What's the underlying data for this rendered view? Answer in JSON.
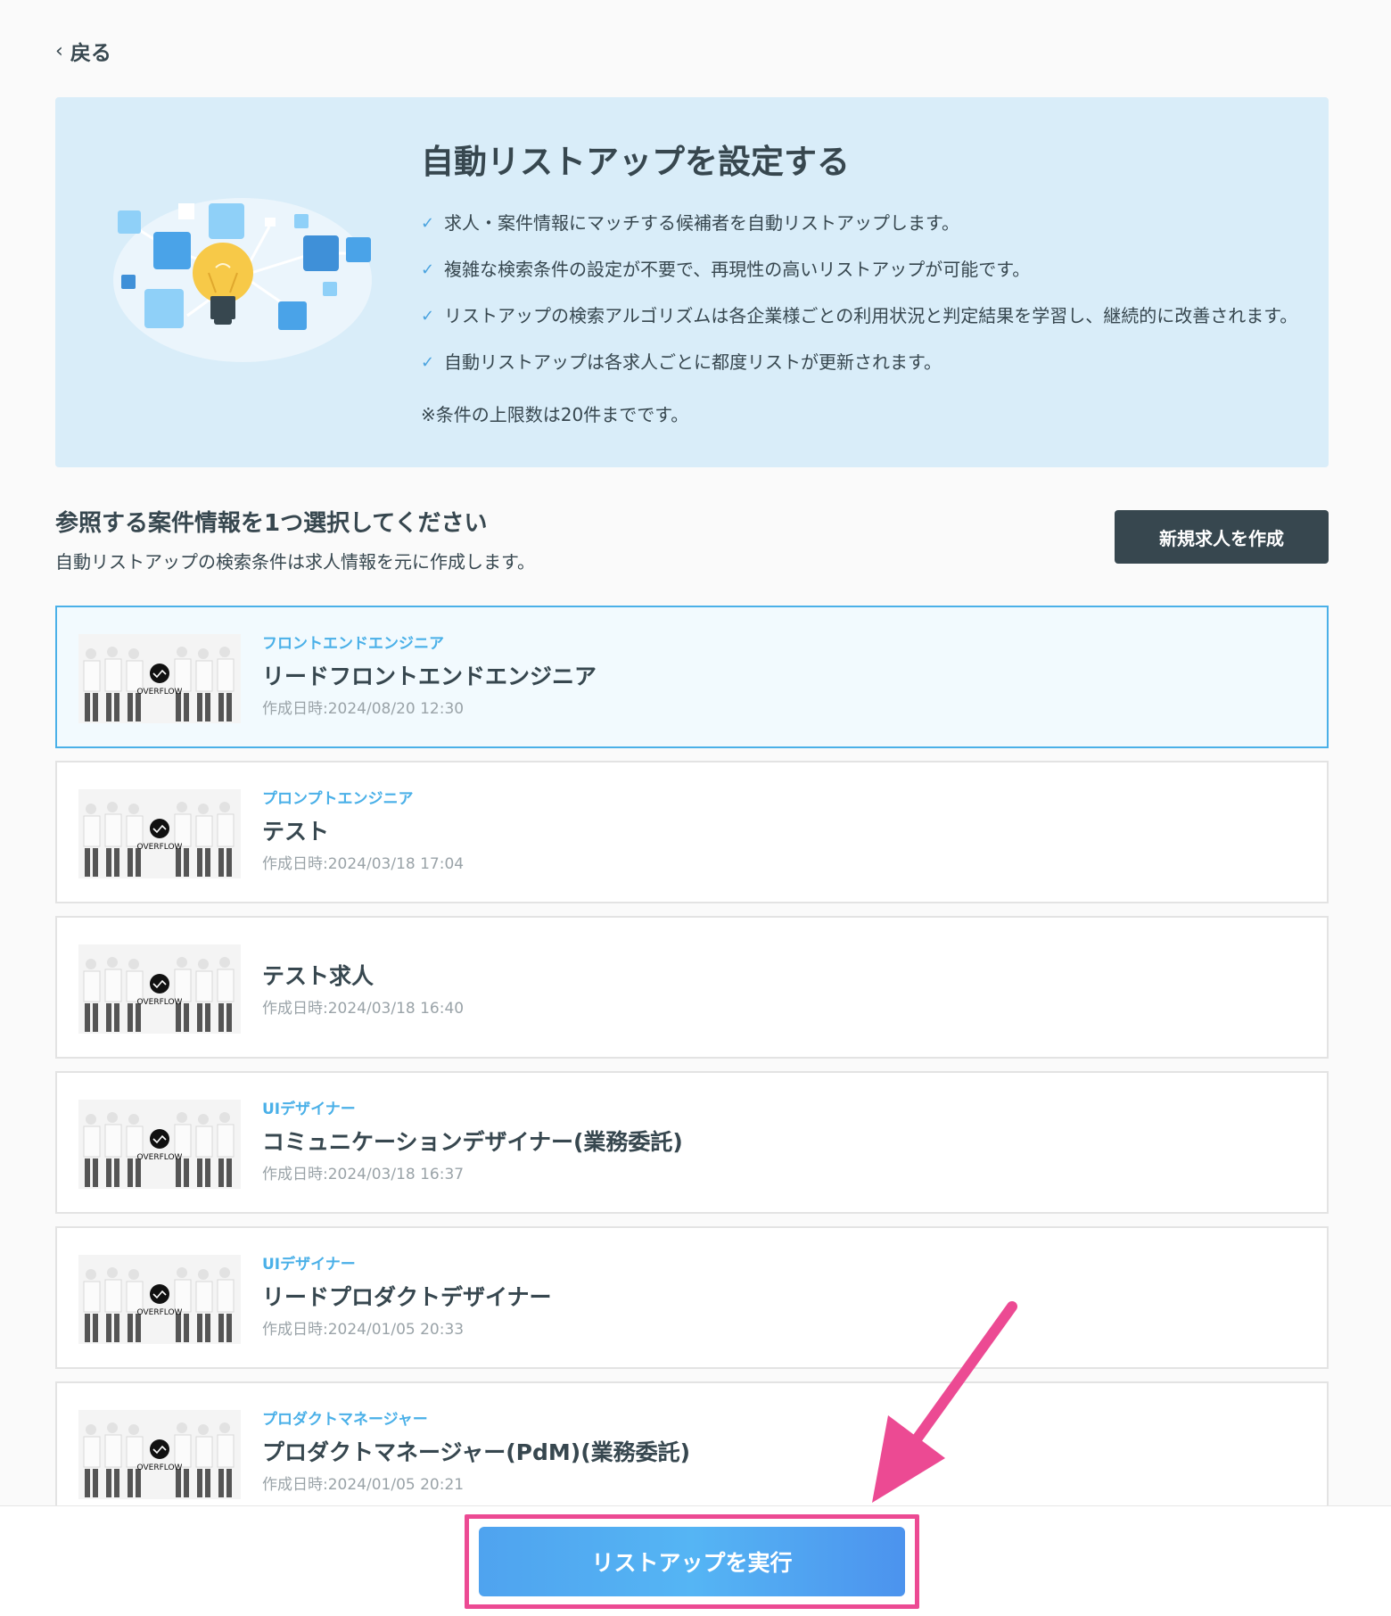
{
  "nav": {
    "back_label": "戻る"
  },
  "hero": {
    "title": "自動リストアップを設定する",
    "points": [
      "求人・案件情報にマッチする候補者を自動リストアップします。",
      "複雑な検索条件の設定が不要で、再現性の高いリストアップが可能です。",
      "リストアップの検索アルゴリズムは各企業様ごとの利用状況と判定結果を学習し、継続的に改善されます。",
      "自動リストアップは各求人ごとに都度リストが更新されます。"
    ],
    "note": "※条件の上限数は20件までです。"
  },
  "section": {
    "title": "参照する案件情報を1つ選択してください",
    "subtitle": "自動リストアップの検索条件は求人情報を元に作成します。",
    "new_button": "新規求人を作成"
  },
  "thumb_logo_text": "OVERFLOW",
  "jobs": [
    {
      "category": "フロントエンドエンジニア",
      "title": "リードフロントエンドエンジニア",
      "created": "作成日時:2024/08/20 12:30"
    },
    {
      "category": "プロンプトエンジニア",
      "title": "テスト",
      "created": "作成日時:2024/03/18 17:04"
    },
    {
      "category": "",
      "title": "テスト求人",
      "created": "作成日時:2024/03/18 16:40"
    },
    {
      "category": "UIデザイナー",
      "title": "コミュニケーションデザイナー(業務委託)",
      "created": "作成日時:2024/03/18 16:37"
    },
    {
      "category": "UIデザイナー",
      "title": "リードプロダクトデザイナー",
      "created": "作成日時:2024/01/05 20:33"
    },
    {
      "category": "プロダクトマネージャー",
      "title": "プロダクトマネージャー(PdM)(業務委託)",
      "created": "作成日時:2024/01/05 20:21"
    }
  ],
  "footer": {
    "run_button": "リストアップを実行"
  },
  "colors": {
    "accent": "#4ab0e8",
    "dark": "#37474f",
    "highlight": "#ec4a93"
  }
}
